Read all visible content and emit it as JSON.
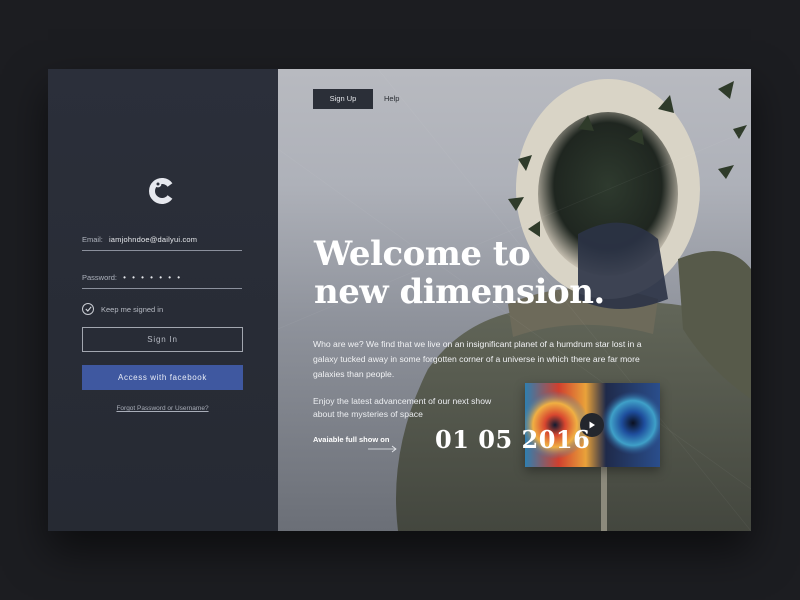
{
  "sidebar": {
    "logo_icon": "c-logo-icon",
    "email": {
      "label": "Email:",
      "value": "iamjohndoe@dailyui.com"
    },
    "password": {
      "label": "Password:",
      "value": "• • • • • • •"
    },
    "keep_signed_in": "Keep me signed in",
    "sign_in_label": "Sign In",
    "facebook_label": "Access with facebook",
    "forgot_label": "Forgot Password or Username?"
  },
  "nav": {
    "sign_up_label": "Sign Up",
    "help_label": "Help"
  },
  "hero": {
    "headline_line1": "Welcome to",
    "headline_line2": "new dimension.",
    "intro": "Who are we? We find that we live on an insignificant planet of a humdrum star lost in a galaxy tucked away in some forgotten corner of a universe in which there are far more galaxies than people.",
    "latest": "Enjoy the latest advancement of our next show about the mysteries of space",
    "available_label": "Avaiable full show on",
    "date": "01 05 2016"
  },
  "video": {
    "play_icon": "play-icon"
  },
  "colors": {
    "sidebar_bg": "#2b2f3a",
    "facebook_blue": "#3f58a0",
    "page_bg": "#1c1d21"
  }
}
